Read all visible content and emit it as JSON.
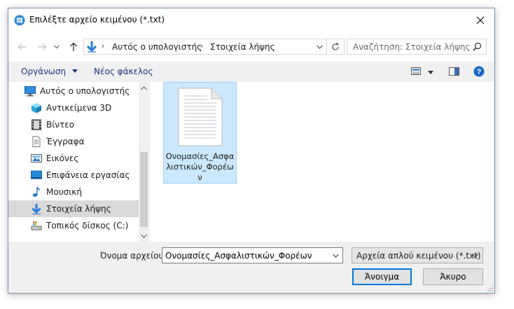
{
  "window": {
    "title": "Επιλέξτε αρχείο κειμένου (*.txt)",
    "title_icon": "notepad-icon",
    "close_icon": "close-icon"
  },
  "address": {
    "back_icon": "arrow-left-icon",
    "forward_icon": "arrow-right-icon",
    "recent_icon": "chevron-down-icon",
    "up_icon": "arrow-up-icon",
    "location_icon": "download-arrow-icon",
    "crumbs": [
      "Αυτός ο υπολογιστής",
      "Στοιχεία λήψης"
    ],
    "search_placeholder": "Αναζήτηση: Στοιχεία λήψης"
  },
  "toolbar": {
    "organize": "Οργάνωση",
    "new_folder": "Νέος φάκελος"
  },
  "nav": {
    "items": [
      {
        "label": "Αυτός ο υπολογιστής",
        "icon": "computer-icon"
      },
      {
        "label": "Αντικείμενα 3D",
        "icon": "cube-3d-icon"
      },
      {
        "label": "Βίντεο",
        "icon": "film-icon"
      },
      {
        "label": "Έγγραφα",
        "icon": "document-icon"
      },
      {
        "label": "Εικόνες",
        "icon": "picture-icon"
      },
      {
        "label": "Επιφάνεια εργασίας",
        "icon": "desktop-icon"
      },
      {
        "label": "Μουσική",
        "icon": "music-note-icon"
      },
      {
        "label": "Στοιχεία λήψης",
        "icon": "download-arrow-icon",
        "selected": true
      },
      {
        "label": "Τοπικός δίσκος (C:)",
        "icon": "disk-drive-icon"
      }
    ]
  },
  "files": [
    {
      "name": "Ονομασίες_Ασφαλιστικών_Φορέων",
      "icon": "text-file-icon",
      "selected": true
    }
  ],
  "bottom": {
    "filename_label": "Όνομα αρχείου:",
    "filename_value": "Ονομασίες_Ασφαλιστικών_Φορέων",
    "filetype": "Αρχεία απλού κειμένου (*.txt)",
    "open_label": "Άνοιγμα",
    "cancel_label": "Άκυρο"
  },
  "colors": {
    "selection": "#cce8ff",
    "selection_border": "#99d1ff",
    "nav_selected": "#d9d9d9",
    "link_text": "#1e3287",
    "primary_border": "#0078d7",
    "help_blue": "#1c69c7"
  }
}
